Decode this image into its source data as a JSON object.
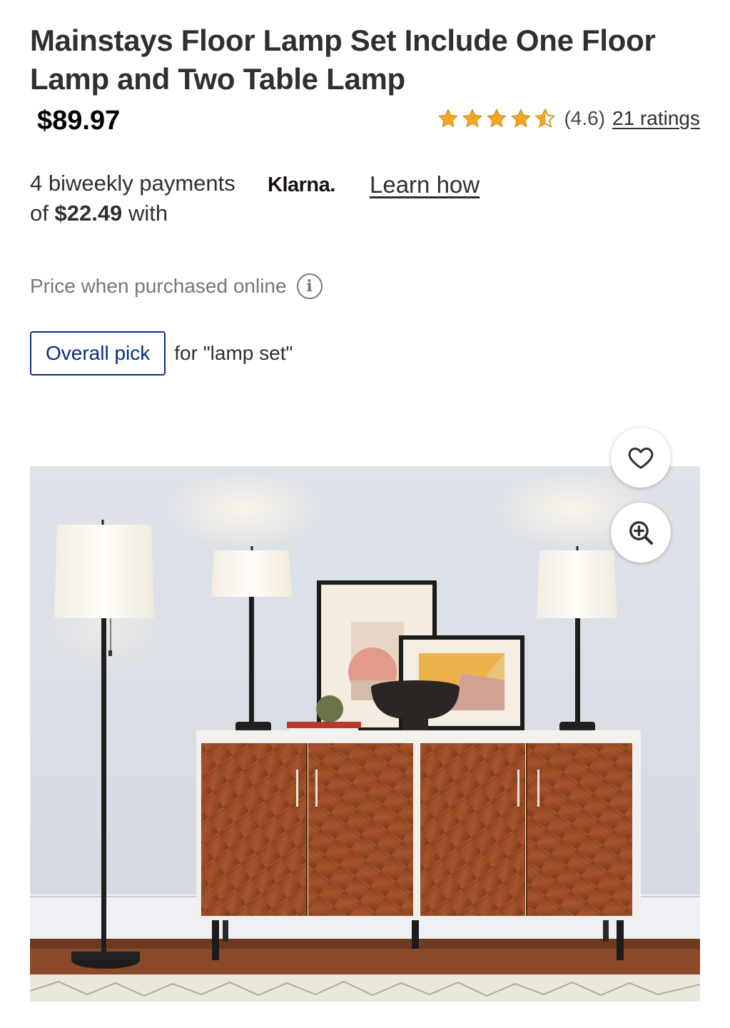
{
  "product": {
    "title": "Mainstays Floor Lamp Set Include One Floor Lamp and Two Table Lamp",
    "price": "$89.97"
  },
  "rating": {
    "value": 4.6,
    "value_label": "(4.6)",
    "count_label": "21 ratings",
    "star_color": "#f5a623",
    "icons": [
      "star-full-icon",
      "star-full-icon",
      "star-full-icon",
      "star-full-icon",
      "star-half-icon"
    ]
  },
  "klarna": {
    "text_prefix": "4 biweekly payments of",
    "amount": "$22.49",
    "text_suffix": "with",
    "logo_text": "Klarna.",
    "learn_label": "Learn how"
  },
  "price_note": {
    "text": "Price when purchased online",
    "icon": "info-icon"
  },
  "badge": {
    "label": "Overall pick",
    "context": "for \"lamp set\"",
    "color": "#0a2d84"
  },
  "image_actions": {
    "favorite_icon": "heart-icon",
    "zoom_icon": "zoom-in-icon"
  }
}
